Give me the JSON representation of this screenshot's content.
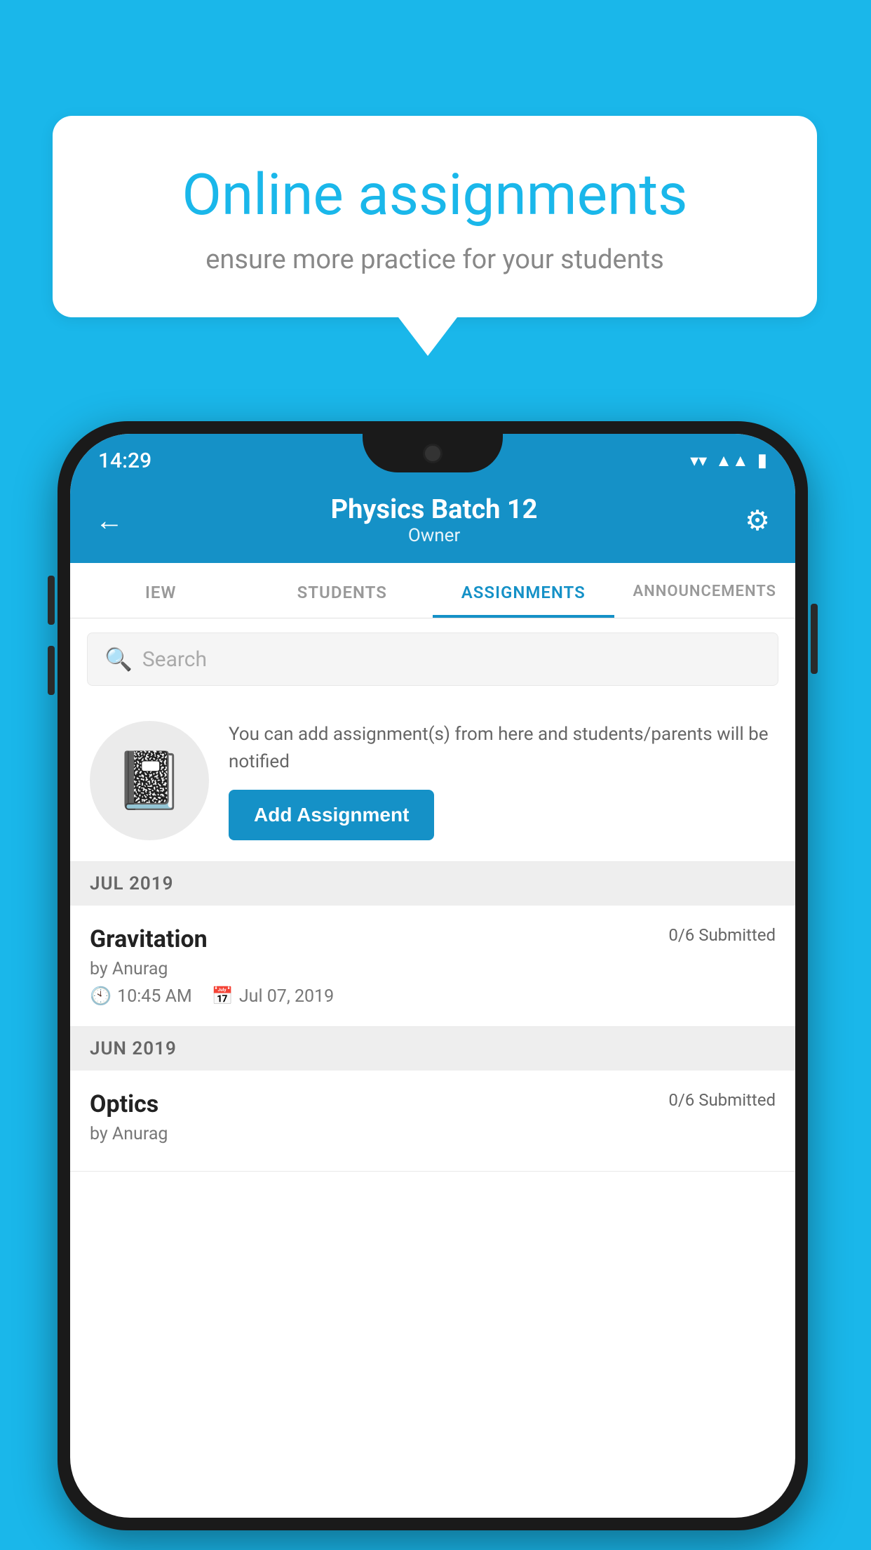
{
  "page": {
    "background_color": "#1ab7ea"
  },
  "speech_bubble": {
    "title": "Online assignments",
    "subtitle": "ensure more practice for your students"
  },
  "status_bar": {
    "time": "14:29",
    "wifi": "▼",
    "signal": "◀",
    "battery": "▮"
  },
  "header": {
    "title": "Physics Batch 12",
    "subtitle": "Owner",
    "back_label": "←",
    "settings_label": "⚙"
  },
  "tabs": [
    {
      "label": "IEW",
      "active": false
    },
    {
      "label": "STUDENTS",
      "active": false
    },
    {
      "label": "ASSIGNMENTS",
      "active": true
    },
    {
      "label": "ANNOUNCEMENTS",
      "active": false
    }
  ],
  "search": {
    "placeholder": "Search"
  },
  "add_assignment": {
    "description": "You can add assignment(s) from here and students/parents will be notified",
    "button_label": "Add Assignment"
  },
  "sections": [
    {
      "month": "JUL 2019",
      "assignments": [
        {
          "name": "Gravitation",
          "submitted": "0/6 Submitted",
          "by": "by Anurag",
          "time": "10:45 AM",
          "date": "Jul 07, 2019"
        }
      ]
    },
    {
      "month": "JUN 2019",
      "assignments": [
        {
          "name": "Optics",
          "submitted": "0/6 Submitted",
          "by": "by Anurag",
          "time": "",
          "date": ""
        }
      ]
    }
  ]
}
